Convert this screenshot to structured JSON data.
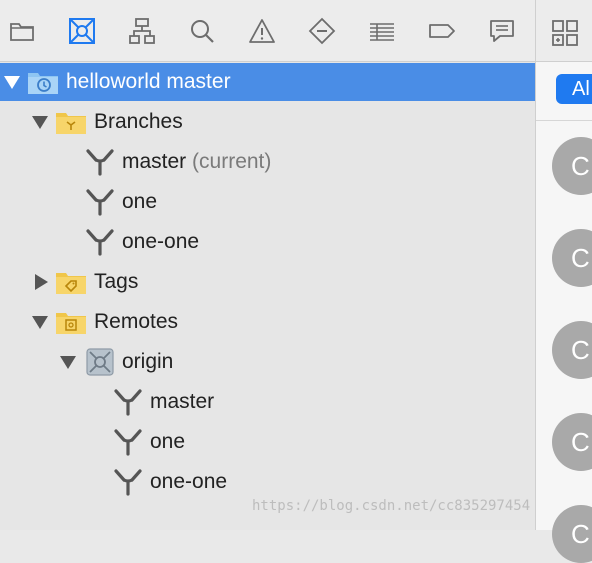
{
  "toolbar": {
    "items": [
      {
        "name": "folder-icon",
        "active": false
      },
      {
        "name": "source-control-icon",
        "active": true
      },
      {
        "name": "hierarchy-icon",
        "active": false
      },
      {
        "name": "search-icon",
        "active": false
      },
      {
        "name": "warning-icon",
        "active": false
      },
      {
        "name": "test-diamond-icon",
        "active": false
      },
      {
        "name": "list-icon",
        "active": false
      },
      {
        "name": "breakpoint-icon",
        "active": false
      },
      {
        "name": "report-icon",
        "active": false
      }
    ],
    "accent_color": "#1f7af0"
  },
  "tree": {
    "repository": "helloworld master",
    "branches_label": "Branches",
    "branches": [
      {
        "name": "master",
        "suffix": "(current)"
      },
      {
        "name": "one"
      },
      {
        "name": "one-one"
      }
    ],
    "tags_label": "Tags",
    "remotes_label": "Remotes",
    "remote_name": "origin",
    "remote_branches": [
      "master",
      "one",
      "one-one"
    ],
    "selection_color": "#4a8de6"
  },
  "right_panel": {
    "filter_label": "Al",
    "avatar_initial": "C"
  },
  "watermark": "https://blog.csdn.net/cc835297454"
}
